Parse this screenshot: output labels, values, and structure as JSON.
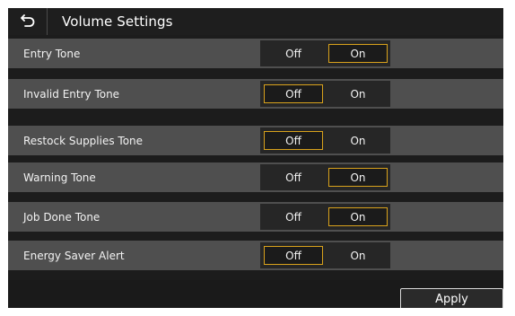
{
  "header": {
    "title": "Volume Settings",
    "back_icon": "back-arrow-icon"
  },
  "rows": [
    {
      "label": "Entry Tone",
      "off_label": "Off",
      "on_label": "On",
      "selected": "On"
    },
    {
      "label": "Invalid Entry Tone",
      "off_label": "Off",
      "on_label": "On",
      "selected": "Off"
    },
    {
      "label": "Restock Supplies Tone",
      "off_label": "Off",
      "on_label": "On",
      "selected": "Off"
    },
    {
      "label": "Warning Tone",
      "off_label": "Off",
      "on_label": "On",
      "selected": "On"
    },
    {
      "label": "Job Done Tone",
      "off_label": "Off",
      "on_label": "On",
      "selected": "On"
    },
    {
      "label": "Energy Saver Alert",
      "off_label": "Off",
      "on_label": "On",
      "selected": "Off"
    }
  ],
  "footer": {
    "apply_label": "Apply"
  },
  "colors": {
    "selection_border": "#d9a21c",
    "row_background": "#4f4f4f",
    "screen_background": "#1c1c1c"
  }
}
